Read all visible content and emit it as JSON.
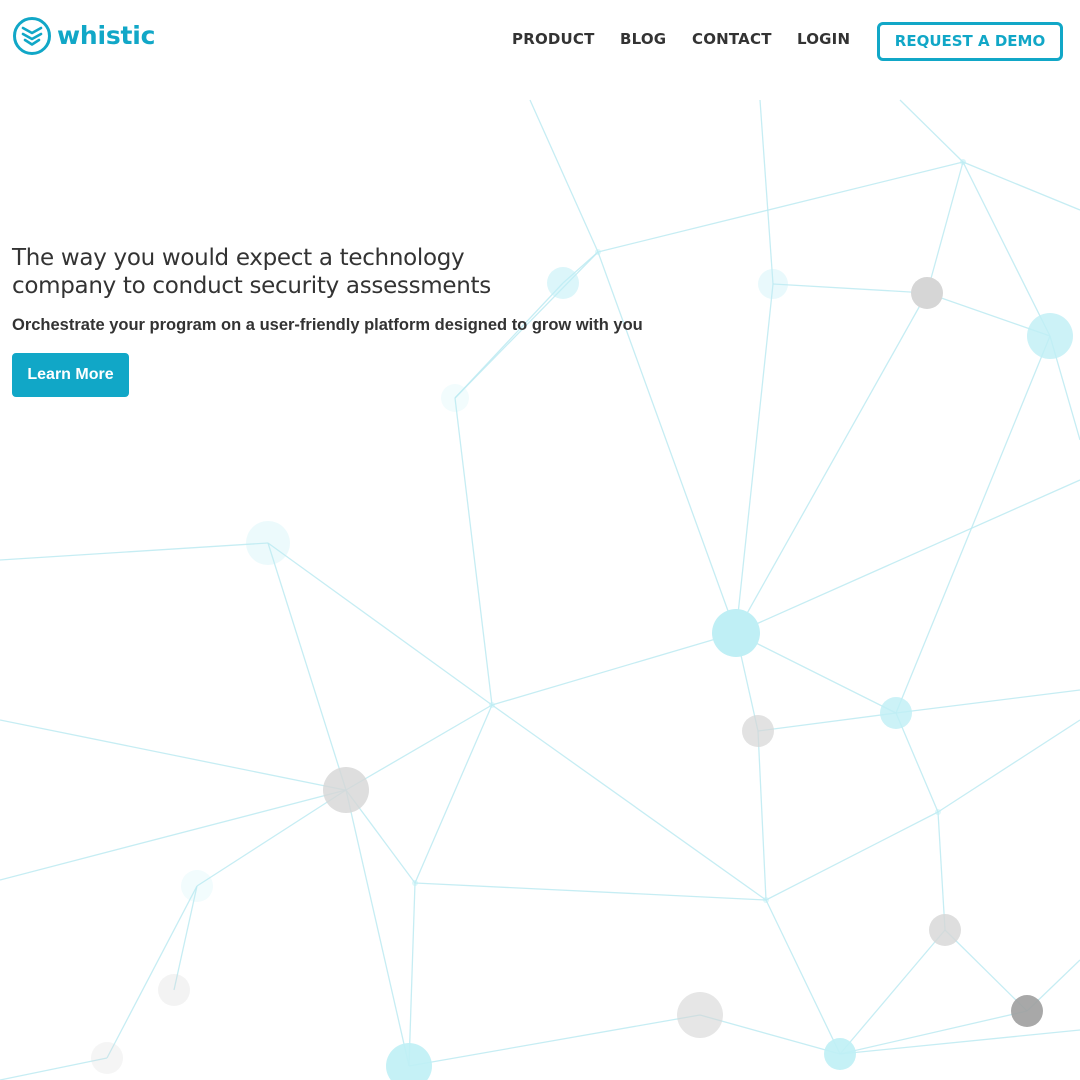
{
  "brand": {
    "name": "whistic",
    "accent_color": "#11a7c7",
    "logo_icon": "whistic-shield-logo-icon"
  },
  "nav": {
    "items": [
      {
        "label": "PRODUCT"
      },
      {
        "label": "BLOG"
      },
      {
        "label": "CONTACT"
      },
      {
        "label": "LOGIN"
      }
    ],
    "cta_label": "REQUEST A DEMO"
  },
  "hero": {
    "title_line1": "The way you would expect a technology",
    "title_line2": "company to conduct security assessments",
    "subtitle": "Orchestrate your program on a user-friendly platform designed to grow with you",
    "button_label": "Learn More"
  },
  "background": {
    "pattern": "network-graph",
    "line_color": "#bdeaf2",
    "node_colors": [
      "#bfeff5",
      "#d6d6d6",
      "#9e9e9e"
    ]
  }
}
